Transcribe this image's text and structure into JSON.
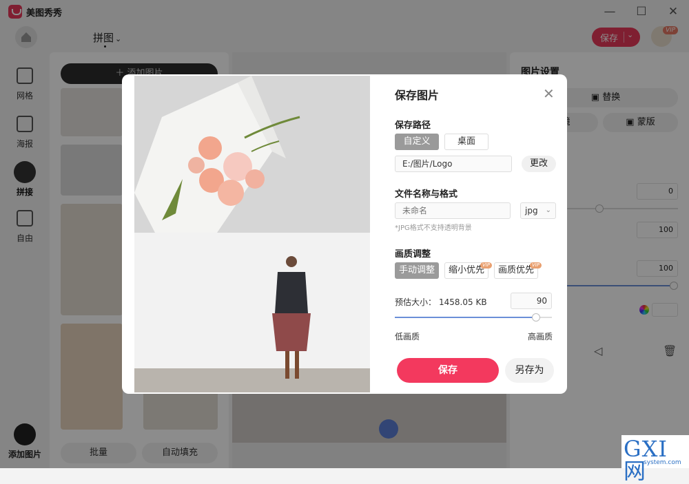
{
  "window": {
    "app_name": "美图秀秀",
    "minimize": "—",
    "maximize": "☐",
    "close": "✕"
  },
  "header": {
    "mode": "拼图",
    "mode_chevron": "⌄",
    "save": "保存",
    "save_chevron": "⌄",
    "vip_badge": "VIP"
  },
  "nav": {
    "items": [
      {
        "label": "网格"
      },
      {
        "label": "海报"
      },
      {
        "label": "拼接"
      },
      {
        "label": "自由"
      }
    ],
    "active": "拼接",
    "add": "添加图片"
  },
  "left": {
    "add_button": "＋ 添加图片",
    "batch": "批量",
    "autofill": "自动填充"
  },
  "right": {
    "title": "图片设置",
    "replace": "替换",
    "mirror_partial": "镜",
    "mask": "蒙版",
    "values": [
      "0",
      "100",
      "100"
    ]
  },
  "dialog": {
    "title": "保存图片",
    "close": "✕",
    "path_label": "保存路径",
    "path_options": [
      "自定义",
      "桌面"
    ],
    "path_selected": "自定义",
    "path_value": "E:/图片/Logo",
    "change": "更改",
    "filename_label": "文件名称与格式",
    "filename_placeholder": "未命名",
    "format": "jpg",
    "format_note": "*JPG格式不支持透明背景",
    "quality_label": "画质调整",
    "quality_options": [
      "手动调整",
      "缩小优先",
      "画质优先"
    ],
    "quality_selected": "手动调整",
    "vip_badge": "VIP",
    "size_label": "预估大小：",
    "size_value": "1458.05 KB",
    "quality_value": "90",
    "quality_level": 0.9,
    "low": "低画质",
    "high": "高画质",
    "save": "保存",
    "save_as": "另存为"
  },
  "watermark": {
    "main": "GXI网",
    "sub": "system.com"
  },
  "colors": {
    "accent": "#f3395e",
    "slider": "#6a8fd8",
    "vip": "#e9a070"
  }
}
